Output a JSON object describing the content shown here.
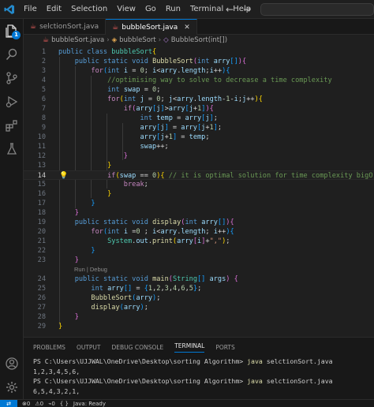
{
  "menu": [
    "File",
    "Edit",
    "Selection",
    "View",
    "Go",
    "Run",
    "Terminal",
    "Help"
  ],
  "nav": {
    "back": "←",
    "forward": "→"
  },
  "activity": {
    "explorer_badge": "1"
  },
  "tabs": [
    {
      "label": "selctionSort.java",
      "active": false
    },
    {
      "label": "bubbleSort.java",
      "active": true
    }
  ],
  "breadcrumb": [
    "bubbleSort.java",
    "bubbleSort",
    "BubbleSort(int[])"
  ],
  "editor": {
    "current_line": 14,
    "lens_label": "Run | Debug"
  },
  "panel": {
    "tabs": [
      "PROBLEMS",
      "OUTPUT",
      "DEBUG CONSOLE",
      "TERMINAL",
      "PORTS"
    ],
    "active_tab": "TERMINAL",
    "terminal": {
      "prompt1": "PS C:\\Users\\UJJWAL\\OneDrive\\Desktop\\sorting Algorithm> ",
      "cmd1": "java",
      "arg1": " selctionSort.java",
      "out1": "1,2,3,4,5,6,",
      "prompt2": "PS C:\\Users\\UJJWAL\\OneDrive\\Desktop\\sorting Algorithm> ",
      "cmd2": "java",
      "arg2": " selctionSort.java",
      "out2": "6,5,4,3,2,1,"
    }
  },
  "status": {
    "errors": "0",
    "warnings": "0",
    "ports": "0",
    "java": "Java: Ready"
  }
}
